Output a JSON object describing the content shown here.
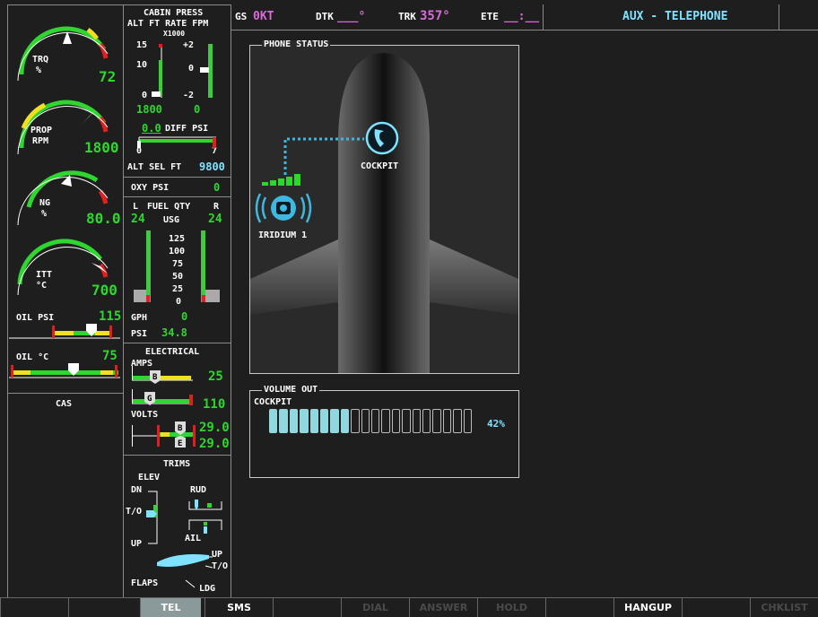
{
  "top_bar": {
    "gs_label": "GS",
    "gs_value": "0KT",
    "dtk_label": "DTK",
    "dtk_value": "___°",
    "trk_label": "TRK",
    "trk_value": "357°",
    "ete_label": "ETE",
    "ete_value": "__:__",
    "page_title": "AUX - TELEPHONE"
  },
  "engine": {
    "trq": {
      "label1": "TRQ",
      "label2": "%",
      "value": "72"
    },
    "prop": {
      "label1": "PROP",
      "label2": "RPM",
      "value": "1800"
    },
    "ng": {
      "label1": "NG",
      "label2": "%",
      "value": "80.0"
    },
    "itt": {
      "label1": "ITT",
      "label2": "°C",
      "value": "700"
    },
    "oil_psi": {
      "label": "OIL PSI",
      "value": "115"
    },
    "oil_c": {
      "label": "OIL °C",
      "value": "75"
    },
    "cas_label": "CAS"
  },
  "cabin_press": {
    "title": "CABIN PRESS",
    "subtitle": "ALT FT RATE FPM",
    "multiplier": "X1000",
    "alt_ticks": [
      "15",
      "10",
      "0"
    ],
    "rate_ticks": [
      "+2",
      "0",
      "-2"
    ],
    "alt_value": "1800",
    "rate_value": "0",
    "diff_value": "0.0",
    "diff_label": "DIFF PSI",
    "diff_min": "0",
    "diff_max": "7",
    "alt_sel_label": "ALT SEL FT",
    "alt_sel_value": "9800"
  },
  "oxy": {
    "label": "OXY PSI",
    "value": "0"
  },
  "fuel": {
    "l_label": "L",
    "title": "FUEL QTY",
    "r_label": "R",
    "l_value": "24",
    "unit": "USG",
    "r_value": "24",
    "scale": [
      "125",
      "100",
      "75",
      "50",
      "25",
      "0"
    ],
    "gph_label": "GPH",
    "gph_value": "0",
    "psi_label": "PSI",
    "psi_value": "34.8"
  },
  "electrical": {
    "title": "ELECTRICAL",
    "amps_label": "AMPS",
    "amps_b_value": "25",
    "amps_g_value": "110",
    "volts_label": "VOLTS",
    "volts_b_value": "29.0",
    "volts_e_value": "29.0",
    "marker_b": "B",
    "marker_g": "G",
    "marker_e": "E"
  },
  "trims": {
    "title": "TRIMS",
    "elev": "ELEV",
    "dn": "DN",
    "to": "T/O",
    "up": "UP",
    "rud": "RUD",
    "ail": "AIL",
    "flaps_label": "FLAPS",
    "flaps_up": "UP",
    "flaps_to": "T/O",
    "flaps_ldg": "LDG"
  },
  "phone_status": {
    "title": "PHONE STATUS",
    "cockpit_label": "COCKPIT",
    "iridium_label": "IRIDIUM 1"
  },
  "volume_out": {
    "title": "VOLUME OUT",
    "channel": "COCKPIT",
    "percent_text": "42%",
    "level": 0.42,
    "total_segments": 20,
    "filled_segments": 8
  },
  "softkeys": [
    {
      "label": "",
      "state": "normal"
    },
    {
      "label": "",
      "state": "normal"
    },
    {
      "label": "TEL",
      "state": "active"
    },
    {
      "label": "SMS",
      "state": "normal"
    },
    {
      "label": "",
      "state": "normal"
    },
    {
      "label": "DIAL",
      "state": "dim"
    },
    {
      "label": "ANSWER",
      "state": "dim"
    },
    {
      "label": "HOLD",
      "state": "dim"
    },
    {
      "label": "",
      "state": "normal"
    },
    {
      "label": "HANGUP",
      "state": "normal"
    },
    {
      "label": "",
      "state": "normal"
    },
    {
      "label": "CHKLIST",
      "state": "dim"
    }
  ],
  "colors": {
    "green": "#2fd62f",
    "magenta": "#d86bd8",
    "cyan": "#7fe3ff",
    "red": "#e02020",
    "yellow": "#f0e020"
  }
}
